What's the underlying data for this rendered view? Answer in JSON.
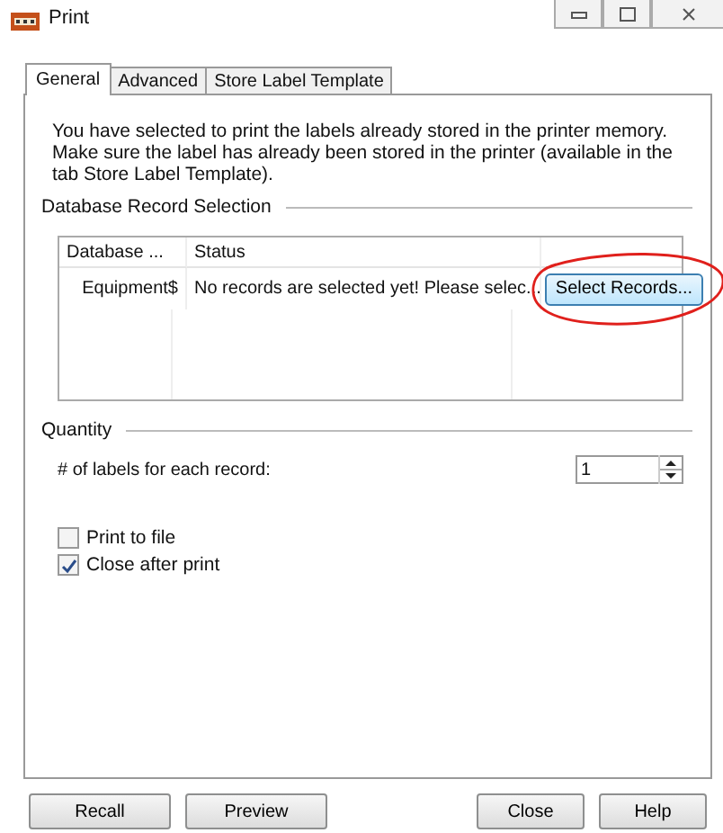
{
  "window": {
    "title": "Print"
  },
  "tabs": [
    {
      "label": "General",
      "selected": true
    },
    {
      "label": "Advanced",
      "selected": false
    },
    {
      "label": "Store Label Template",
      "selected": false
    }
  ],
  "info": "You have selected to print the labels already stored in the printer memory. Make sure the label has already been stored in the printer (available in the tab Store Label Template).",
  "database_section": {
    "title": "Database Record Selection",
    "columns": [
      "Database ...",
      "Status"
    ],
    "rows": [
      {
        "database": "Equipment$",
        "status": "No records are selected yet! Please selec...",
        "button": "Select Records..."
      }
    ]
  },
  "quantity_section": {
    "title": "Quantity",
    "label": "# of labels for each record:",
    "value": "1"
  },
  "options": [
    {
      "label": "Print to file",
      "checked": false
    },
    {
      "label": "Close after print",
      "checked": true
    }
  ],
  "buttons_left": [
    "Recall",
    "Preview"
  ],
  "buttons_right": [
    "Close",
    "Help"
  ]
}
